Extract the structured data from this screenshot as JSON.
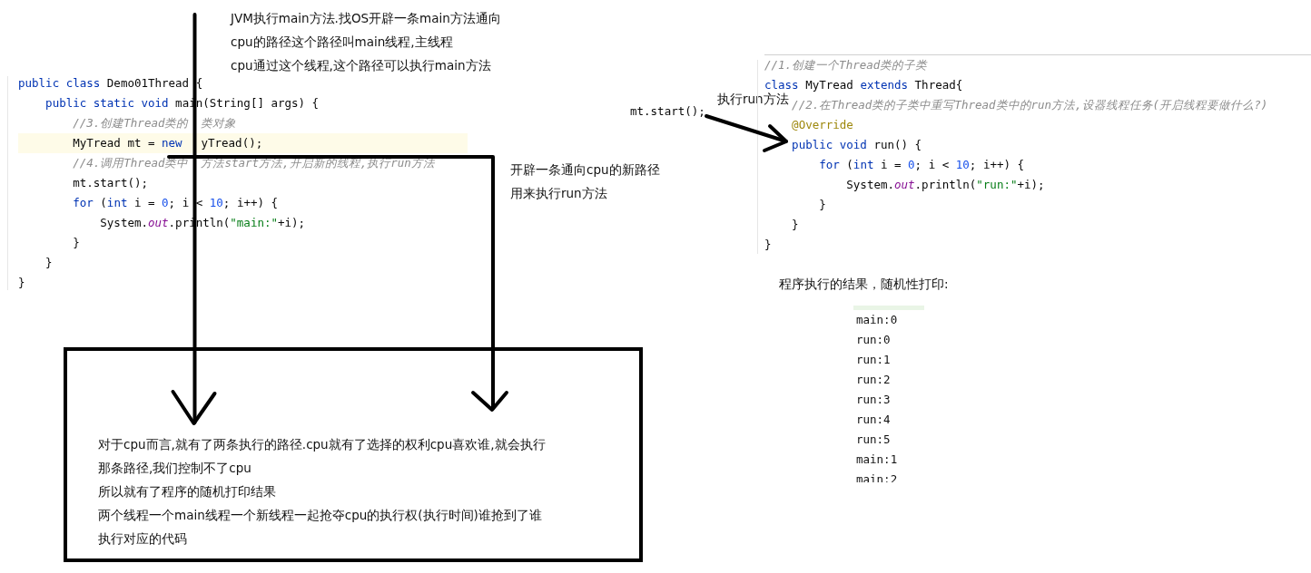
{
  "main_code": {
    "lines": [
      {
        "highlighted": false,
        "tokens": [
          {
            "kind": "keyword",
            "text": "public class"
          },
          {
            "kind": "plain",
            "text": " Demo01Thread {"
          }
        ]
      },
      {
        "highlighted": false,
        "tokens": [
          {
            "kind": "keyword",
            "text": "    public static void"
          },
          {
            "kind": "plain",
            "text": " main(String[] args) {"
          }
        ]
      },
      {
        "highlighted": false,
        "tokens": [
          {
            "kind": "comment",
            "text": "        //3.创建Thread类的"
          },
          {
            "kind": "gap"
          },
          {
            "kind": "comment",
            "text": "类对象"
          }
        ]
      },
      {
        "highlighted": true,
        "tokens": [
          {
            "kind": "plain",
            "text": "        MyTread mt = "
          },
          {
            "kind": "keyword",
            "text": "new"
          },
          {
            "kind": "gap"
          },
          {
            "kind": "plain",
            "text": "yTread();"
          }
        ]
      },
      {
        "highlighted": false,
        "tokens": [
          {
            "kind": "comment",
            "text": "        //4.调用Thread类中"
          },
          {
            "kind": "gap"
          },
          {
            "kind": "comment",
            "text": "方法start方法,开启新的线程,执行run方法"
          }
        ]
      },
      {
        "highlighted": false,
        "tokens": [
          {
            "kind": "plain",
            "text": "        mt.start();"
          }
        ]
      },
      {
        "highlighted": false,
        "tokens": [
          {
            "kind": "keyword",
            "text": "        for"
          },
          {
            "kind": "plain",
            "text": " ("
          },
          {
            "kind": "keyword",
            "text": "int"
          },
          {
            "kind": "plain",
            "text": " i = "
          },
          {
            "kind": "number",
            "text": "0"
          },
          {
            "kind": "plain",
            "text": "; i < "
          },
          {
            "kind": "number",
            "text": "10"
          },
          {
            "kind": "plain",
            "text": "; i++) {"
          }
        ]
      },
      {
        "highlighted": false,
        "tokens": [
          {
            "kind": "plain",
            "text": "            System."
          },
          {
            "kind": "field",
            "text": "out"
          },
          {
            "kind": "plain",
            "text": ".println("
          },
          {
            "kind": "string",
            "text": "\"main:\""
          },
          {
            "kind": "plain",
            "text": "+i);"
          }
        ]
      },
      {
        "highlighted": false,
        "tokens": [
          {
            "kind": "plain",
            "text": "        }"
          }
        ]
      },
      {
        "highlighted": false,
        "tokens": [
          {
            "kind": "plain",
            "text": "    }"
          }
        ]
      },
      {
        "highlighted": false,
        "tokens": [
          {
            "kind": "plain",
            "text": "}"
          }
        ]
      }
    ]
  },
  "main_thread_note": [
    "JVM执行main方法.找OS开辟一条main方法通向",
    "cpu的路径这个路径叫main线程,主线程",
    "cpu通过这个线程,这个路径可以执行main方法"
  ],
  "new_thread_note": [
    "开辟一条通向cpu的新路径",
    "用来执行run方法"
  ],
  "call_label": "mt.start();",
  "call_note": "执行run方法",
  "thread_class_code": {
    "lines": [
      {
        "tokens": [
          {
            "kind": "comment",
            "text": "//1.创建一个Thread类的子类"
          }
        ]
      },
      {
        "tokens": [
          {
            "kind": "keyword",
            "text": "class"
          },
          {
            "kind": "plain",
            "text": " MyTread "
          },
          {
            "kind": "keyword",
            "text": "extends"
          },
          {
            "kind": "plain",
            "text": " Thread{"
          }
        ]
      },
      {
        "tokens": [
          {
            "kind": "comment",
            "text": "    //2.在Thread类的子类中重写Thread类中的run方法,设器线程任务(开启线程要做什么?)"
          }
        ]
      },
      {
        "tokens": [
          {
            "kind": "annotation",
            "text": "    @Override"
          }
        ]
      },
      {
        "tokens": [
          {
            "kind": "keyword",
            "text": "    public void"
          },
          {
            "kind": "plain",
            "text": " run() {"
          }
        ]
      },
      {
        "tokens": [
          {
            "kind": "keyword",
            "text": "        for"
          },
          {
            "kind": "plain",
            "text": " ("
          },
          {
            "kind": "keyword",
            "text": "int"
          },
          {
            "kind": "plain",
            "text": " i = "
          },
          {
            "kind": "number",
            "text": "0"
          },
          {
            "kind": "plain",
            "text": "; i < "
          },
          {
            "kind": "number",
            "text": "10"
          },
          {
            "kind": "plain",
            "text": "; i++) {"
          }
        ]
      },
      {
        "tokens": [
          {
            "kind": "plain",
            "text": "            System."
          },
          {
            "kind": "field",
            "text": "out"
          },
          {
            "kind": "plain",
            "text": ".println("
          },
          {
            "kind": "string",
            "text": "\"run:\""
          },
          {
            "kind": "plain",
            "text": "+i);"
          }
        ]
      },
      {
        "tokens": [
          {
            "kind": "plain",
            "text": "        }"
          }
        ]
      },
      {
        "tokens": [
          {
            "kind": "plain",
            "text": "    }"
          }
        ]
      },
      {
        "tokens": [
          {
            "kind": "plain",
            "text": "}"
          }
        ]
      }
    ]
  },
  "output": {
    "title": "程序执行的结果，随机性打印:",
    "lines": [
      "main:0",
      "run:0",
      "run:1",
      "run:2",
      "run:3",
      "run:4",
      "run:5",
      "main:1",
      "main:2"
    ]
  },
  "explanation": [
    "对于cpu而言,就有了两条执行的路径.cpu就有了选择的权利cpu喜欢谁,就会执行",
    "那条路径,我们控制不了cpu",
    "所以就有了程序的随机打印结果",
    "两个线程一个main线程一个新线程一起抢夺cpu的执行权(执行时间)谁抢到了谁",
    "执行对应的代码"
  ]
}
